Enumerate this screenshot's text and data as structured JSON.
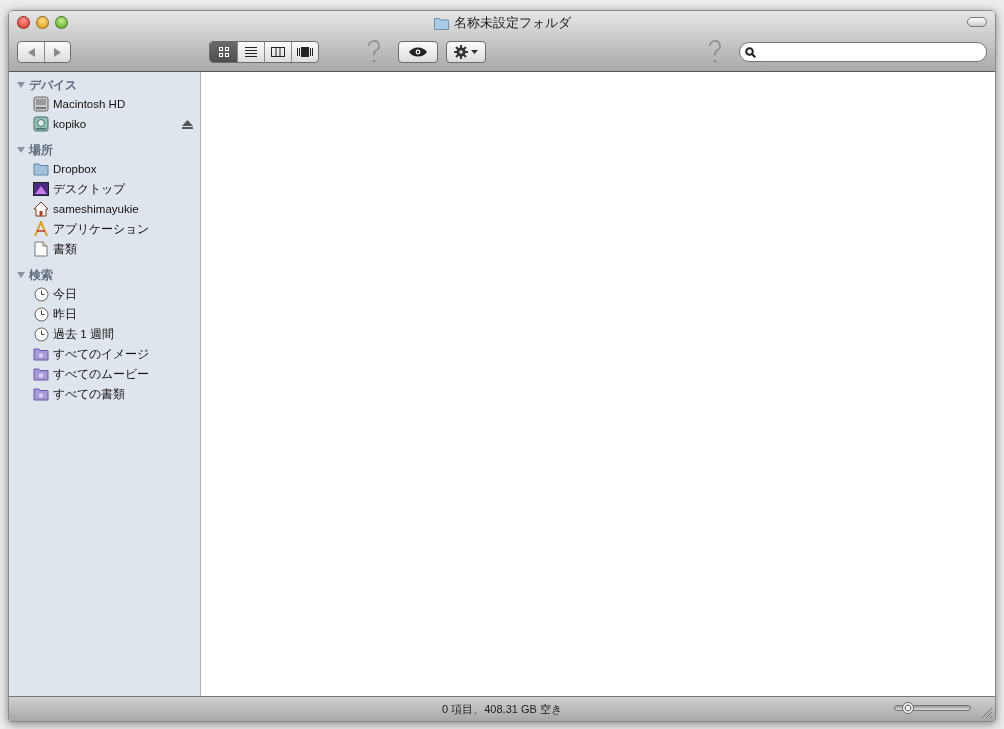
{
  "window": {
    "title": "名称未設定フォルダ"
  },
  "toolbar": {
    "views": [
      {
        "kind": "icon",
        "selected": true
      },
      {
        "kind": "list",
        "selected": false
      },
      {
        "kind": "columns",
        "selected": false
      },
      {
        "kind": "coverflow",
        "selected": false
      }
    ]
  },
  "sidebar": {
    "sections": [
      {
        "title": "デバイス",
        "expanded": true,
        "items": [
          {
            "label": "Macintosh HD",
            "kind": "disk",
            "eject": false
          },
          {
            "label": "kopiko",
            "kind": "external-disk",
            "eject": true
          }
        ]
      },
      {
        "title": "場所",
        "expanded": true,
        "items": [
          {
            "label": "Dropbox",
            "kind": "folder",
            "eject": false
          },
          {
            "label": "デスクトップ",
            "kind": "desktop",
            "eject": false
          },
          {
            "label": "sameshimayukie",
            "kind": "home",
            "eject": false
          },
          {
            "label": "アプリケーション",
            "kind": "apps",
            "eject": false
          },
          {
            "label": "書類",
            "kind": "document",
            "eject": false
          }
        ]
      },
      {
        "title": "検索",
        "expanded": true,
        "items": [
          {
            "label": "今日",
            "kind": "clock",
            "eject": false
          },
          {
            "label": "昨日",
            "kind": "clock",
            "eject": false
          },
          {
            "label": "過去 1 週間",
            "kind": "clock",
            "eject": false
          },
          {
            "label": "すべてのイメージ",
            "kind": "smart-folder",
            "eject": false
          },
          {
            "label": "すべてのムービー",
            "kind": "smart-folder",
            "eject": false
          },
          {
            "label": "すべての書類",
            "kind": "smart-folder",
            "eject": false
          }
        ]
      }
    ]
  },
  "status_bar": {
    "text": "0 項目、408.31 GB 空き",
    "zoom": {
      "level": 0.17
    }
  }
}
